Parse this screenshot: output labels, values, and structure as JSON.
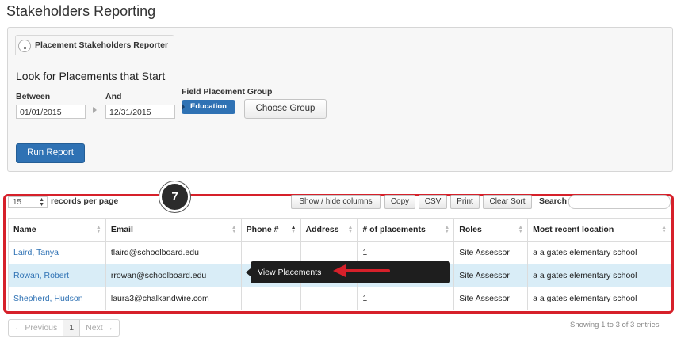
{
  "page": {
    "title": "Stakeholders Reporting"
  },
  "report_panel": {
    "tab_label": "Placement Stakeholders Reporter",
    "heading": "Look for Placements that Start",
    "between_label": "Between",
    "between_value": "01/01/2015",
    "and_label": "And",
    "and_value": "12/31/2015",
    "group_label": "Field Placement Group",
    "group_tag": "Education",
    "choose_group_label": "Choose Group",
    "run_report_label": "Run Report"
  },
  "annotation": {
    "step_number": "7",
    "color": "#d6202a"
  },
  "table_controls": {
    "records_per_page_value": "15",
    "records_per_page_label": "records per page",
    "show_hide_columns": "Show / hide columns",
    "copy": "Copy",
    "csv": "CSV",
    "print": "Print",
    "clear_sort": "Clear Sort",
    "search_label": "Search:"
  },
  "table": {
    "columns": [
      "Name",
      "Email",
      "Phone #",
      "Address",
      "# of placements",
      "Roles",
      "Most recent location"
    ],
    "rows": [
      {
        "name": "Laird, Tanya",
        "email": "tlaird@schoolboard.edu",
        "phone": "",
        "address": "",
        "placements": "1",
        "roles": "Site Assessor",
        "location": "a a gates elementary school"
      },
      {
        "name": "Rowan, Robert",
        "email": "rrowan@schoolboard.edu",
        "phone": "",
        "address": "",
        "placements": "",
        "roles": "Site Assessor",
        "location": "a a gates elementary school"
      },
      {
        "name": "Shepherd, Hudson",
        "email": "laura3@chalkandwire.com",
        "phone": "",
        "address": "",
        "placements": "1",
        "roles": "Site Assessor",
        "location": "a a gates elementary school"
      }
    ]
  },
  "tooltip": {
    "label": "View Placements"
  },
  "pagination": {
    "previous": "← Previous",
    "current": "1",
    "next": "Next →",
    "info": "Showing 1 to 3 of 3 entries"
  },
  "colors": {
    "accent": "#2f72b4",
    "row_highlight": "#d9edf7",
    "annotation_red": "#d6202a"
  }
}
